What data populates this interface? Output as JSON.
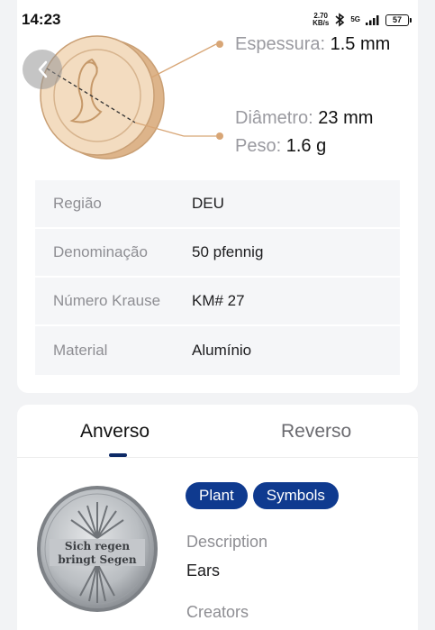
{
  "status": {
    "time": "14:23",
    "net_speed_value": "2.70",
    "net_speed_unit": "KB/s",
    "network": "5G",
    "battery": "57"
  },
  "specs": {
    "thickness_label": "Espessura:",
    "thickness_value": "1.5 mm",
    "diameter_label": "Diâmetro:",
    "diameter_value": "23 mm",
    "weight_label": "Peso:",
    "weight_value": "1.6 g"
  },
  "info_rows": [
    {
      "label": "Região",
      "value": "DEU"
    },
    {
      "label": "Denominação",
      "value": "50 pfennig"
    },
    {
      "label": "Número Krause",
      "value": "KM# 27"
    },
    {
      "label": "Material",
      "value": "Alumínio"
    }
  ],
  "tabs": {
    "obverse": "Anverso",
    "reverse": "Reverso"
  },
  "tags": [
    "Plant",
    "Symbols"
  ],
  "description": {
    "label": "Description",
    "value": "Ears"
  },
  "creators": {
    "label": "Creators"
  },
  "coin_inscription": {
    "line1": "Sich regen",
    "line2": "bringt Segen"
  },
  "colors": {
    "accent": "#0f3a8f",
    "coin_gold": "#e8c9a3"
  }
}
